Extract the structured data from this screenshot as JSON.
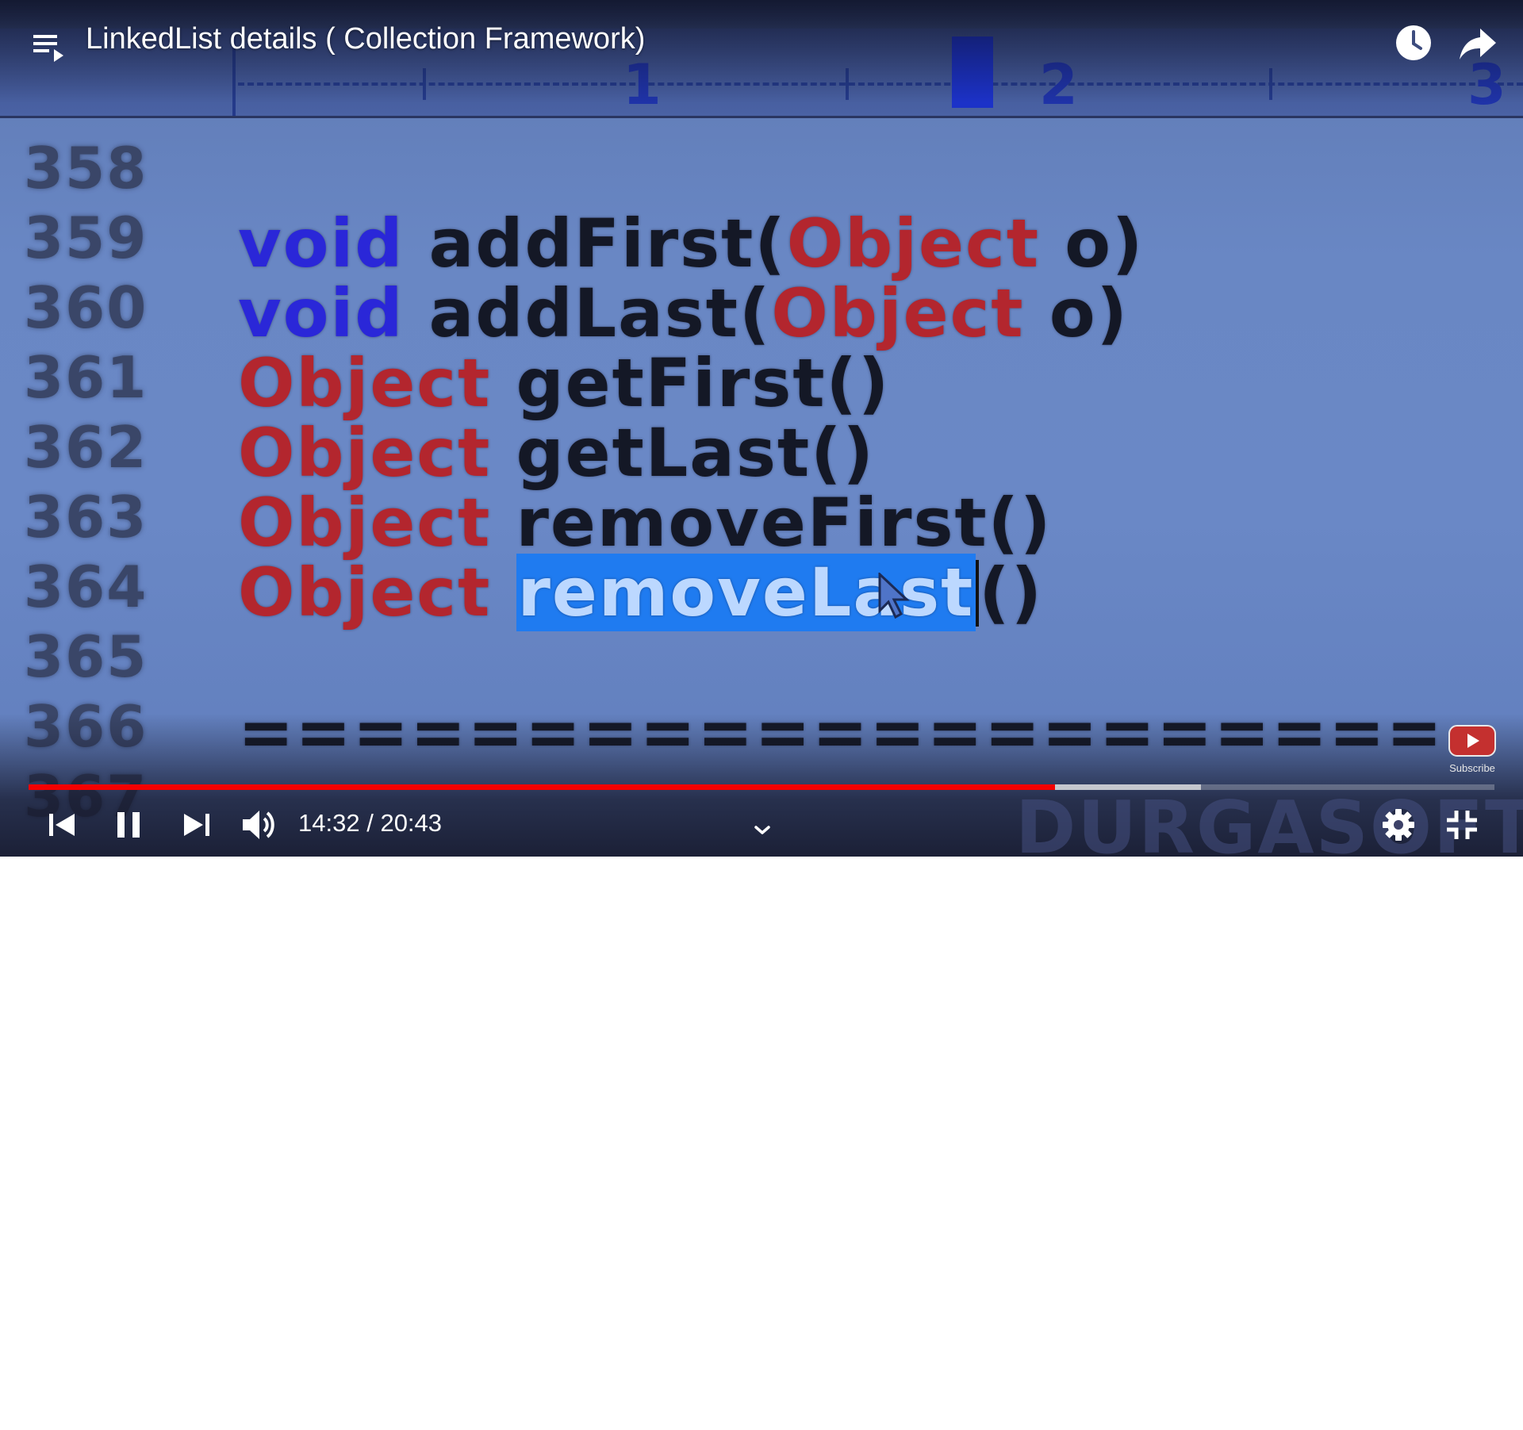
{
  "player": {
    "title": "LinkedList details ( Collection Framework)",
    "current_time": "14:32",
    "time_separator": "/",
    "duration": "20:43",
    "progress_played": 0.7,
    "progress_buffered": 0.8,
    "subscribe_label": "Subscribe",
    "watermark": "DURGASOFT",
    "colors": {
      "played": "#f40000",
      "selection": "#1f7bf0"
    }
  },
  "video_frame": {
    "ruler_numbers": [
      "1",
      "2",
      "3"
    ],
    "lines": [
      {
        "no": "358",
        "segments": []
      },
      {
        "no": "359",
        "segments": [
          {
            "t": "void",
            "k": "void"
          },
          {
            "t": " addFirst(",
            "k": ""
          },
          {
            "t": "Object",
            "k": "obj"
          },
          {
            "t": " o)",
            "k": ""
          }
        ]
      },
      {
        "no": "360",
        "segments": [
          {
            "t": "void",
            "k": "void"
          },
          {
            "t": " addLast(",
            "k": ""
          },
          {
            "t": "Object",
            "k": "obj"
          },
          {
            "t": " o)",
            "k": ""
          }
        ]
      },
      {
        "no": "361",
        "segments": [
          {
            "t": "Object",
            "k": "obj"
          },
          {
            "t": " getFirst()",
            "k": ""
          }
        ]
      },
      {
        "no": "362",
        "segments": [
          {
            "t": "Object",
            "k": "obj"
          },
          {
            "t": " getLast()",
            "k": ""
          }
        ]
      },
      {
        "no": "363",
        "segments": [
          {
            "t": "Object",
            "k": "obj"
          },
          {
            "t": " removeFirst()",
            "k": ""
          }
        ]
      },
      {
        "no": "364",
        "segments": [
          {
            "t": "Object",
            "k": "obj"
          },
          {
            "t": " ",
            "k": ""
          },
          {
            "t": "removeLast",
            "k": "sel"
          },
          {
            "t": "",
            "k": "caret"
          },
          {
            "t": "()",
            "k": ""
          }
        ]
      },
      {
        "no": "365",
        "segments": []
      },
      {
        "no": "366",
        "segments": [
          {
            "t": "=====================",
            "k": ""
          }
        ]
      },
      {
        "no": "367",
        "segments": []
      }
    ]
  },
  "icons": {
    "playlist": "playlist-icon",
    "watch_later": "clock-icon",
    "share": "share-arrow-icon",
    "previous": "skip-previous-icon",
    "pause": "pause-icon",
    "next": "skip-next-icon",
    "volume": "volume-icon",
    "chevron": "chevron-down-icon",
    "settings": "gear-icon",
    "exit_fullscreen": "exit-fullscreen-icon"
  }
}
